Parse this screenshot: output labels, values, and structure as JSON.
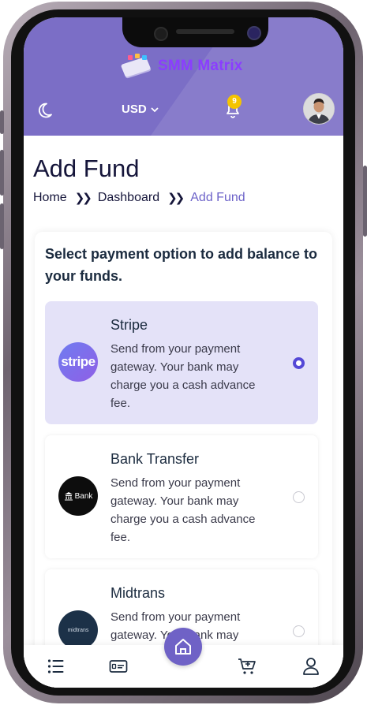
{
  "app": {
    "brand": "SMM Matrix",
    "currency": "USD",
    "notifications_count": "9"
  },
  "page": {
    "title": "Add Fund",
    "breadcrumbs": [
      "Home",
      "Dashboard",
      "Add Fund"
    ]
  },
  "payment": {
    "heading": "Select payment option to add balance to your funds.",
    "options": [
      {
        "name": "Stripe",
        "logo_text": "stripe",
        "description": "Send from your payment gateway. Your bank may charge you a cash advance fee.",
        "selected": true
      },
      {
        "name": "Bank Transfer",
        "logo_text": "Bank",
        "description": "Send from your payment gateway. Your bank may charge you a cash advance fee.",
        "selected": false
      },
      {
        "name": "Midtrans",
        "logo_text": "midtrans",
        "description": "Send from your payment gateway. Your bank may",
        "selected": false
      }
    ]
  },
  "bottom_nav": {
    "items": [
      "menu-icon",
      "wallet-icon",
      "home-icon",
      "cart-icon",
      "user-icon"
    ]
  },
  "colors": {
    "header": "#7b6ec6",
    "accent": "#5448d6",
    "selected_bg": "#e4e2f8",
    "badge": "#f5c400"
  }
}
